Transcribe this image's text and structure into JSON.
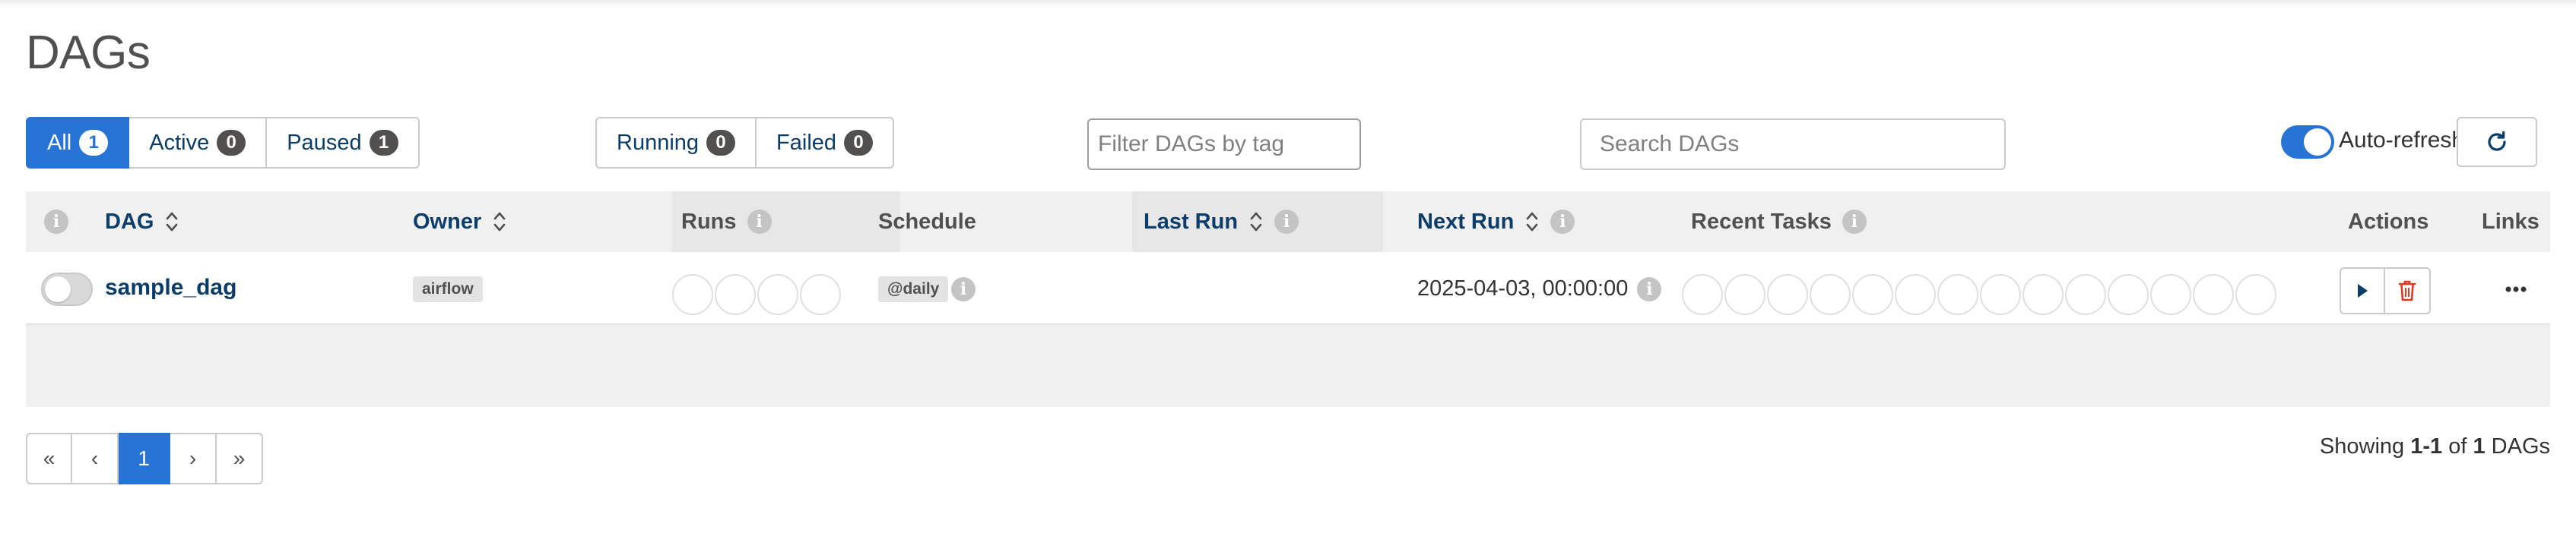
{
  "page": {
    "title": "DAGs"
  },
  "status_filters": [
    {
      "label": "All",
      "count": "1",
      "active": true
    },
    {
      "label": "Active",
      "count": "0",
      "active": false
    },
    {
      "label": "Paused",
      "count": "1",
      "active": false
    }
  ],
  "run_filters": [
    {
      "label": "Running",
      "count": "0"
    },
    {
      "label": "Failed",
      "count": "0"
    }
  ],
  "tag_filter": {
    "placeholder": "Filter DAGs by tag",
    "value": ""
  },
  "search": {
    "placeholder": "Search DAGs",
    "value": ""
  },
  "auto_refresh": {
    "label": "Auto-refresh",
    "enabled": true
  },
  "table": {
    "headers": {
      "dag": "DAG",
      "owner": "Owner",
      "runs": "Runs",
      "schedule": "Schedule",
      "last_run": "Last Run",
      "next_run": "Next Run",
      "recent_tasks": "Recent Tasks",
      "actions": "Actions",
      "links": "Links"
    },
    "rows": [
      {
        "paused": true,
        "dag_id": "sample_dag",
        "owner": "airflow",
        "schedule": "@daily",
        "last_run": "",
        "next_run": "2025-04-03, 00:00:00",
        "run_states": 4,
        "task_states": 14
      }
    ]
  },
  "pagination": {
    "first": "«",
    "prev": "‹",
    "current": "1",
    "next": "›",
    "last": "»"
  },
  "summary": {
    "prefix": "Showing",
    "range": "1-1",
    "of": "of",
    "total": "1",
    "suffix": "DAGs"
  },
  "colors": {
    "accent": "#2874d6",
    "link": "#0b3d6b",
    "delete": "#e43921",
    "badge": "#51504f"
  },
  "icons": [
    "info-icon",
    "sort-icon",
    "refresh-icon",
    "play-icon",
    "trash-icon",
    "ellipsis-icon"
  ]
}
